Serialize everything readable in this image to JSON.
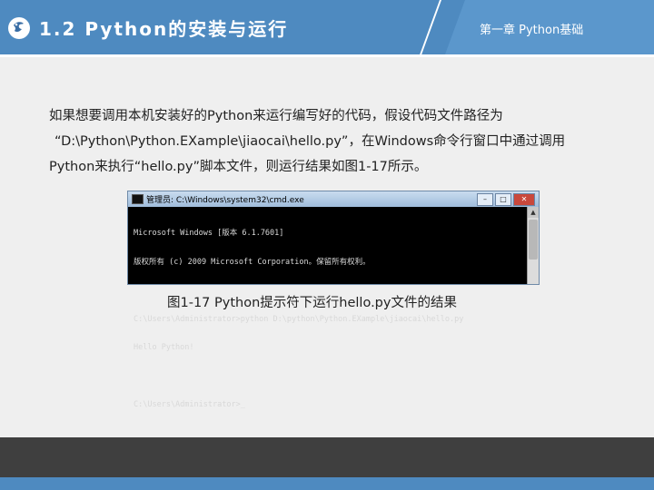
{
  "header": {
    "title": "1.2 Python的安装与运行",
    "chapter": "第一章 Python基础"
  },
  "body": {
    "lines": [
      "如果想要调用本机安装好的Python来运行编写好的代码，假设代码文件路径为",
      "“D:\\Python\\Python.EXample\\jiaocai\\hello.py”，在Windows命令行窗口中通过调用",
      "Python来执行“hello.py”脚本文件，则运行结果如图1-17所示。"
    ]
  },
  "window": {
    "title": "管理员: C:\\Windows\\system32\\cmd.exe",
    "console_lines": [
      "Microsoft Windows [版本 6.1.7601]",
      "版权所有 (c) 2009 Microsoft Corporation。保留所有权利。",
      "",
      "C:\\Users\\Administrator>python D:\\python\\Python.EXample\\jiaocai\\hello.py",
      "Hello Python!",
      "",
      "C:\\Users\\Administrator>_"
    ]
  },
  "caption": "图1-17   Python提示符下运行hello.py文件的结果",
  "colors": {
    "header": "#4e8ac0",
    "footer": "#3f3f3f",
    "background": "#efefef"
  },
  "icons": [
    "python-logo-icon",
    "cmd-window-icon"
  ]
}
